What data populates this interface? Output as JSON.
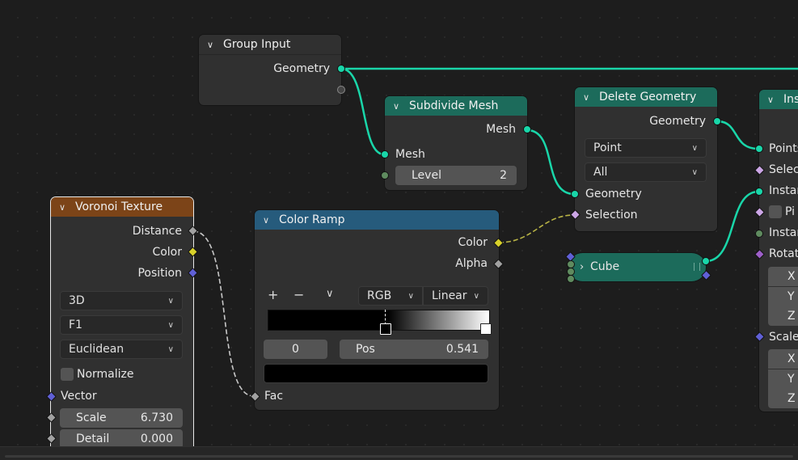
{
  "colors": {
    "geometry_socket": "#19d6a9",
    "geometry_header": "#1c6b5b",
    "texture_header": "#7c4418",
    "converter_header": "#265b7c",
    "background": "#1d1d1d"
  },
  "group_input": {
    "title": "Group Input",
    "geometry": "Geometry"
  },
  "subdivide_mesh": {
    "title": "Subdivide Mesh",
    "out_mesh": "Mesh",
    "in_mesh": "Mesh",
    "level_label": "Level",
    "level_value": "2"
  },
  "delete_geometry": {
    "title": "Delete Geometry",
    "out_geometry": "Geometry",
    "domain": "Point",
    "mode": "All",
    "in_geometry": "Geometry",
    "selection": "Selection"
  },
  "instance_node": {
    "title": "Ins",
    "points": "Points",
    "selection": "Selec",
    "instance": "Instan",
    "pick": "Pi",
    "instance_index": "Instar",
    "rotation": "Rotat",
    "rot_x": "X",
    "rot_y": "Y",
    "rot_z": "Z",
    "scale": "Scale",
    "sc_x": "X",
    "sc_y": "Y",
    "sc_z": "Z"
  },
  "voronoi": {
    "title": "Voronoi Texture",
    "distance": "Distance",
    "color": "Color",
    "position": "Position",
    "dimensions": "3D",
    "feature": "F1",
    "metric": "Euclidean",
    "normalize": "Normalize",
    "vector": "Vector",
    "scale_label": "Scale",
    "scale_value": "6.730",
    "detail_label": "Detail",
    "detail_value": "0.000"
  },
  "color_ramp": {
    "title": "Color Ramp",
    "out_color": "Color",
    "out_alpha": "Alpha",
    "add": "+",
    "remove": "−",
    "menu": "∨",
    "color_mode": "RGB",
    "interpolation": "Linear",
    "stop_index": "0",
    "pos_label": "Pos",
    "pos_value": "0.541",
    "fac": "Fac",
    "stop_position": 0.541,
    "current_color": "#000000"
  },
  "cube": {
    "label": "Cube",
    "chevron": "›"
  }
}
